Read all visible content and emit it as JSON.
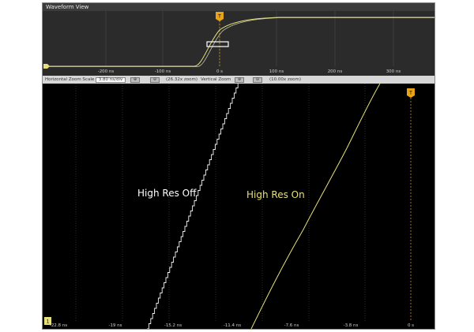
{
  "window": {
    "title": "Waveform View"
  },
  "colors": {
    "trace_on": "#e6e07a",
    "trace_off": "#f2f2f2",
    "trigger": "#e8a317",
    "grid": "#4a4a4a"
  },
  "overview": {
    "time_labels": [
      "-200 ns",
      "-100 ns",
      "0 s",
      "100 ns",
      "200 ns",
      "300 ns"
    ],
    "trigger_marker": "T"
  },
  "zoom_bar": {
    "horizontal_label": "Horizontal Zoom Scale",
    "horizontal_value": "3.80 ns/div",
    "horizontal_zoom": "(26.32x zoom)",
    "vertical_label": "Vertical Zoom",
    "vertical_zoom": "(10.00x zoom)"
  },
  "main": {
    "time_labels": [
      "-22.8 ns",
      "-19 ns",
      "-15.2 ns",
      "-11.4 ns",
      "-7.6 ns",
      "-3.8 ns",
      "0 s"
    ],
    "trace_off_label": "High Res Off",
    "trace_on_label": "High Res On",
    "trigger_marker": "T",
    "channel_marker": "1"
  }
}
